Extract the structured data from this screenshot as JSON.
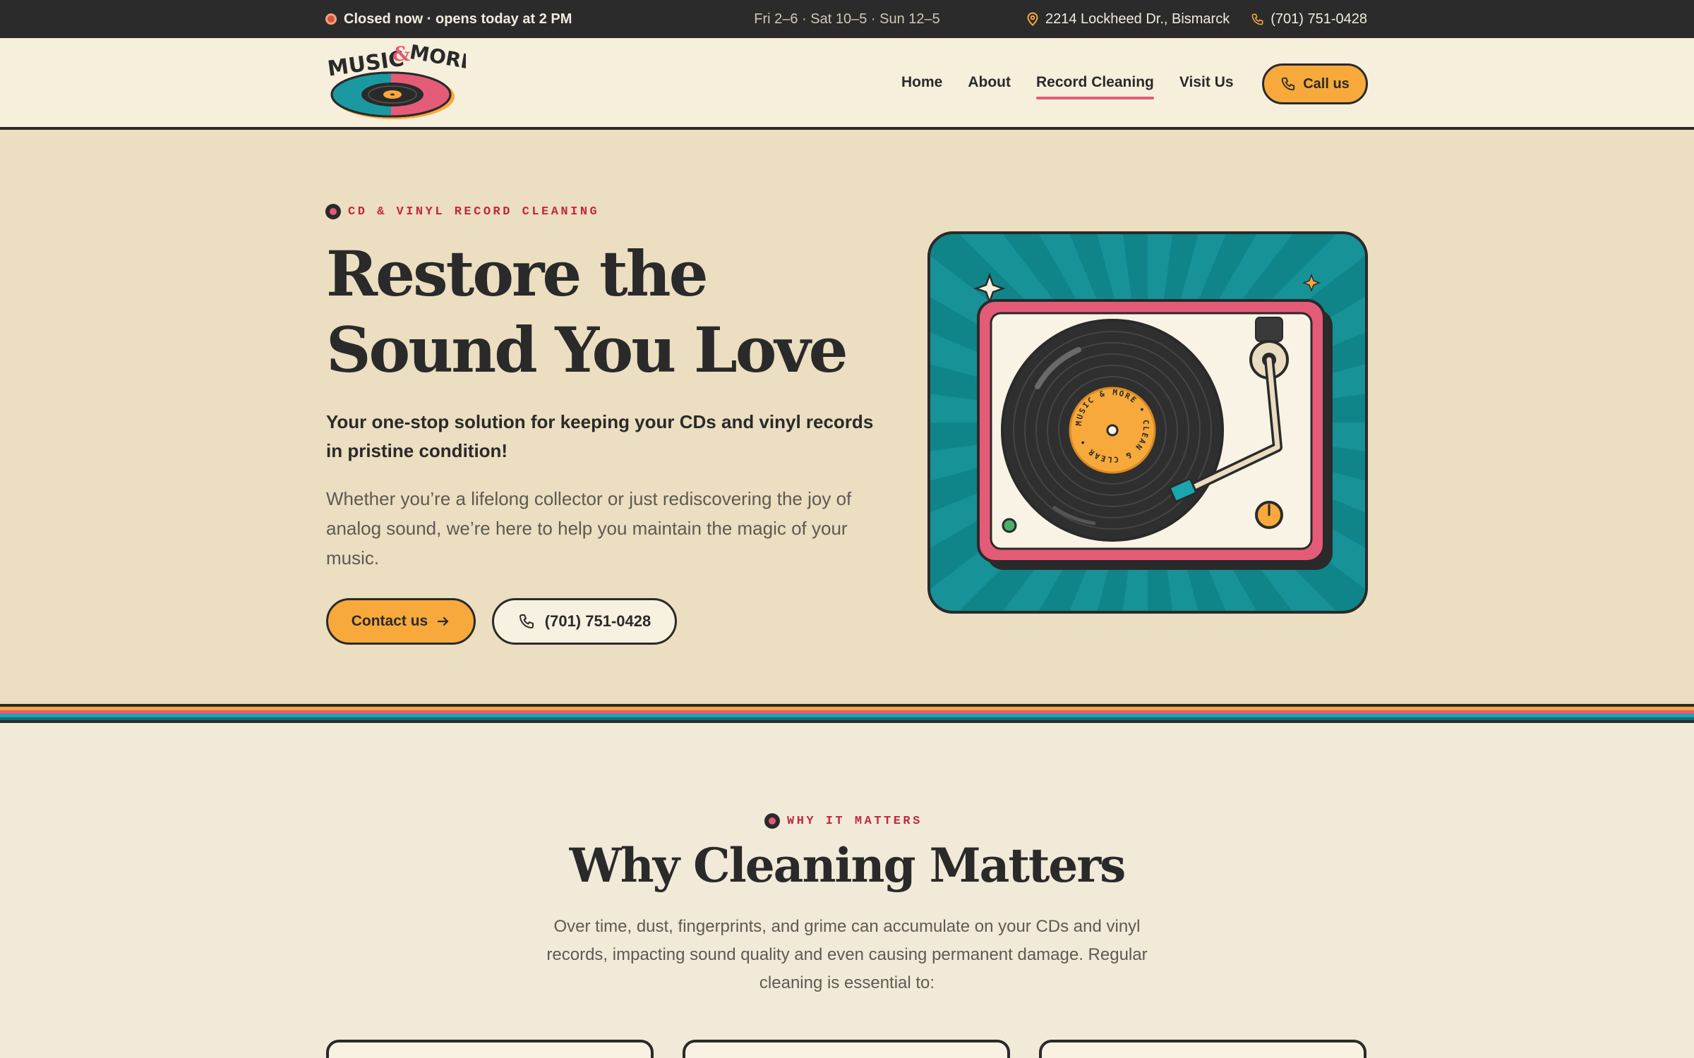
{
  "topbar": {
    "status": "Closed now · opens today at 2 PM",
    "hours": "Fri 2–6 · Sat 10–5 · Sun 12–5",
    "address": "2214 Lockheed Dr., Bismarck",
    "phone": "(701) 751-0428"
  },
  "brand": {
    "logo_text_1": "MUSIC",
    "logo_text_amp": "&",
    "logo_text_2": "MORE"
  },
  "nav": {
    "items": [
      {
        "label": "Home"
      },
      {
        "label": "About"
      },
      {
        "label": "Record Cleaning"
      },
      {
        "label": "Visit Us"
      }
    ],
    "active": "Record Cleaning",
    "call_label": "Call us"
  },
  "hero": {
    "eyebrow": "CD & VINYL RECORD CLEANING",
    "title_line1": "Restore the",
    "title_line2": "Sound You Love",
    "lead": "Your one-stop solution for keeping your CDs and vinyl records in pristine condition!",
    "body": "Whether you’re a lifelong collector or just rediscovering the joy of analog sound, we’re here to help you maintain the magic of your music.",
    "primary_button": "Contact us",
    "secondary_button": "(701) 751-0428",
    "record_label_text": "MUSIC & MORE • CLEAN & CLEAR •"
  },
  "why": {
    "eyebrow": "WHY IT MATTERS",
    "title": "Why Cleaning Matters",
    "body": "Over time, dust, fingerprints, and grime can accumulate on your CDs and vinyl records, impacting sound quality and even causing permanent damage. Regular cleaning is essential to:"
  },
  "colors": {
    "ink": "#2a2a2a",
    "cream": "#f2ead8",
    "hero_bg": "#ebdec1",
    "orange": "#f7a93b",
    "pink": "#e45b78",
    "teal": "#0f8a8f",
    "red_text": "#c0283f"
  },
  "icons": [
    "status-dot-icon",
    "map-pin-icon",
    "phone-icon",
    "arrow-right-icon",
    "record-icon",
    "sparkle-icon"
  ]
}
